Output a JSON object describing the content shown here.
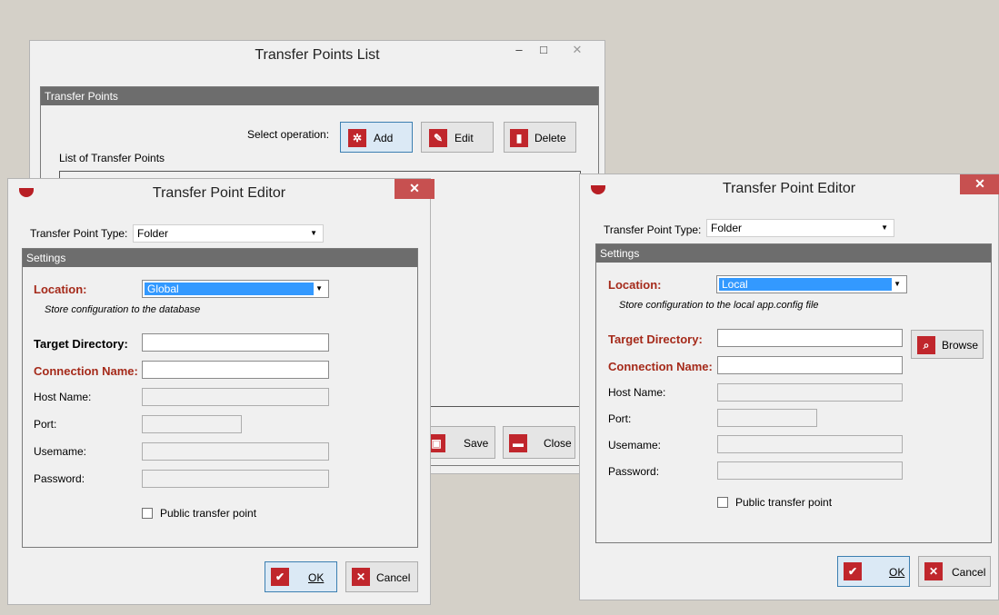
{
  "list_window": {
    "title": "Transfer Points List",
    "minimize": "–",
    "maximize": "□",
    "close": "✕",
    "group_title": "Transfer Points",
    "select_operation": "Select operation:",
    "add_label": "Add",
    "edit_label": "Edit",
    "delete_label": "Delete",
    "list_label": "List of Transfer Points",
    "save_label": "Save",
    "close_label": "Close"
  },
  "editor_left": {
    "title": "Transfer Point Editor",
    "close": "✕",
    "type_label": "Transfer Point Type:",
    "type_value": "Folder",
    "settings_title": "Settings",
    "location_label": "Location:",
    "location_value": "Global",
    "location_note": "Store configuration to the database",
    "target_label": "Target Directory:",
    "target_value": "",
    "connection_label": "Connection Name:",
    "connection_value": "",
    "host_label": "Host Name:",
    "host_value": "",
    "port_label": "Port:",
    "port_value": "",
    "username_label": "Usemame:",
    "username_value": "",
    "password_label": "Password:",
    "password_value": "",
    "public_label": "Public transfer point",
    "public_checked": false,
    "ok_label": "OK",
    "cancel_label": "Cancel"
  },
  "editor_right": {
    "title": "Transfer Point Editor",
    "close": "✕",
    "type_label": "Transfer Point Type:",
    "type_value": "Folder",
    "settings_title": "Settings",
    "location_label": "Location:",
    "location_value": "Local",
    "location_note": "Store configuration to the local app.config file",
    "target_label": "Target Directory:",
    "target_value": "",
    "browse_label": "Browse",
    "connection_label": "Connection Name:",
    "connection_value": "",
    "host_label": "Host Name:",
    "host_value": "",
    "port_label": "Port:",
    "port_value": "",
    "username_label": "Usemame:",
    "username_value": "",
    "password_label": "Password:",
    "password_value": "",
    "public_label": "Public transfer point",
    "public_checked": false,
    "ok_label": "OK",
    "cancel_label": "Cancel"
  },
  "icons": {
    "add": "gear-icon",
    "edit": "edit-icon",
    "delete": "trash-icon",
    "save": "save-icon",
    "close": "close-window-icon",
    "browse": "folder-search-icon",
    "ok": "checkmark-icon",
    "cancel": "x-icon",
    "dropdown": "▼"
  },
  "colors": {
    "accent_red": "#c0262c",
    "label_red": "#a52a1a",
    "header_gray": "#6d6d6d",
    "selection_blue": "#3399ff",
    "close_red": "#c75050"
  }
}
